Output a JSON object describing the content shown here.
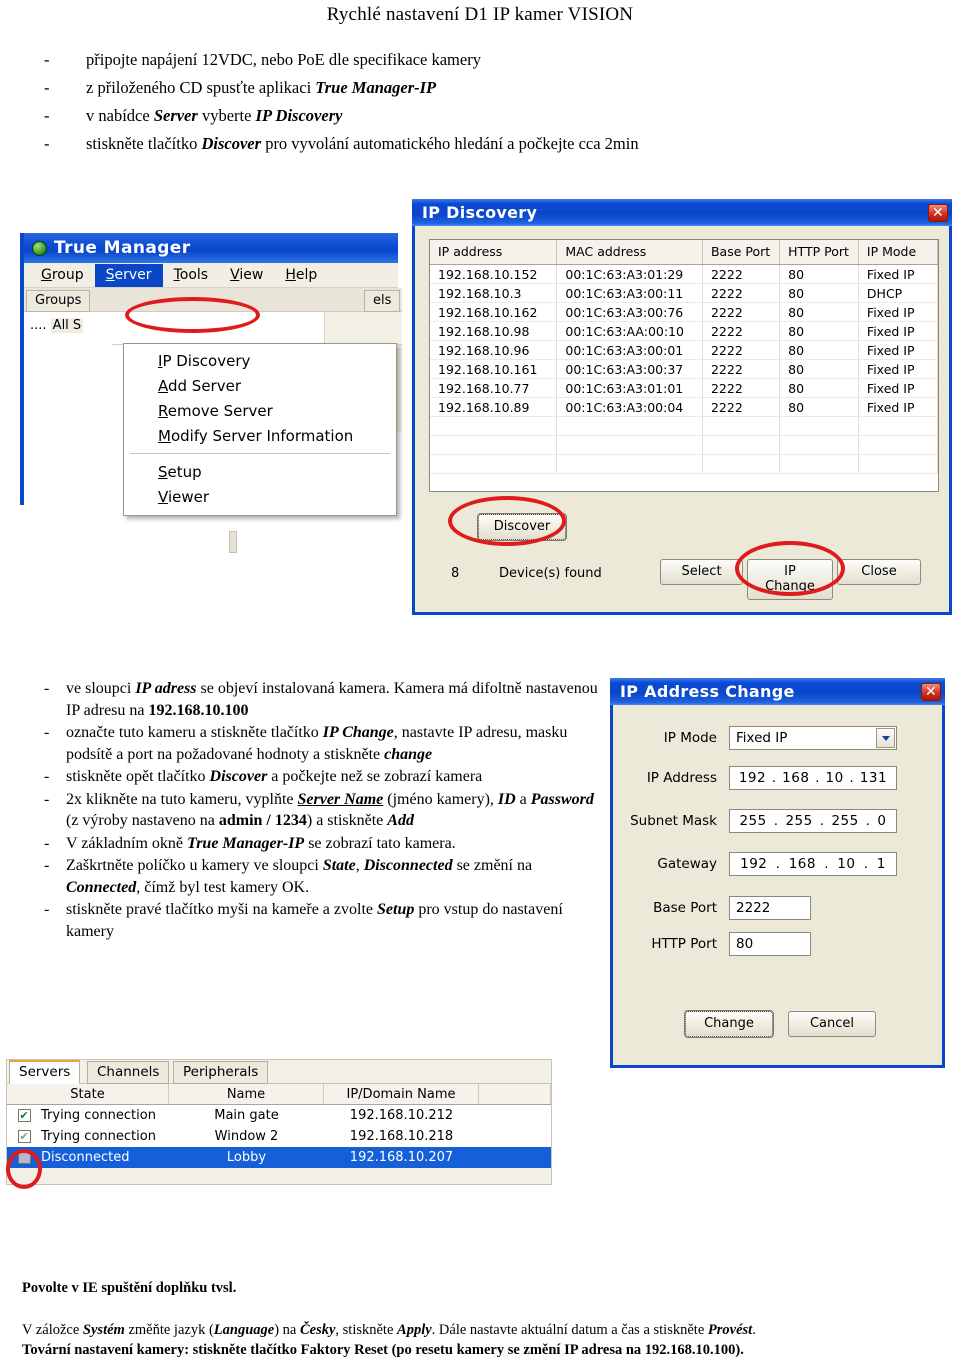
{
  "document": {
    "title": "Rychlé nastavení D1 IP kamer VISION",
    "intro_bullets": [
      {
        "dash": "-",
        "parts": [
          {
            "t": "připojte napájení 12VDC, nebo PoE dle specifikace kamery",
            "s": "n"
          }
        ]
      },
      {
        "dash": "-",
        "parts": [
          {
            "t": "z přiloženého CD spusťte aplikaci ",
            "s": "n"
          },
          {
            "t": "True Manager-IP",
            "s": "bi"
          }
        ]
      },
      {
        "dash": "-",
        "parts": [
          {
            "t": "v nabídce ",
            "s": "n"
          },
          {
            "t": "Server",
            "s": "bi"
          },
          {
            "t": "  vyberte ",
            "s": "n"
          },
          {
            "t": "IP Discovery",
            "s": "bi"
          }
        ]
      },
      {
        "dash": "-",
        "parts": [
          {
            "t": "stiskněte tlačítko ",
            "s": "n"
          },
          {
            "t": "Discover",
            "s": "bi"
          },
          {
            "t": "  pro vyvolání automatického hledání a počkejte cca 2min",
            "s": "n"
          }
        ]
      }
    ]
  },
  "true_manager": {
    "title": "True Manager",
    "app_icon": "true-manager-app-icon",
    "menu": [
      {
        "label": "Group",
        "mnemonic": "G",
        "active": false
      },
      {
        "label": "Server",
        "mnemonic": "S",
        "active": true
      },
      {
        "label": "Tools",
        "mnemonic": "T",
        "active": false
      },
      {
        "label": "View",
        "mnemonic": "V",
        "active": false
      },
      {
        "label": "Help",
        "mnemonic": "H",
        "active": false
      }
    ],
    "tabs": [
      "Groups",
      "els"
    ],
    "tree_node": "All S",
    "dropdown": {
      "items": [
        {
          "label": "IP Discovery",
          "mnemonic": "I",
          "sep_after": false
        },
        {
          "label": "Add Server",
          "mnemonic": "A",
          "sep_after": false
        },
        {
          "label": "Remove Server",
          "mnemonic": "R",
          "sep_after": false
        },
        {
          "label": "Modify Server Information",
          "mnemonic": "M",
          "sep_after": true
        },
        {
          "label": "Setup",
          "mnemonic": "S",
          "sep_after": false
        },
        {
          "label": "Viewer",
          "mnemonic": "V",
          "sep_after": false
        }
      ]
    }
  },
  "ip_discovery": {
    "title": "IP Discovery",
    "close_glyph": "✕",
    "columns": [
      "IP address",
      "MAC address",
      "Base Port",
      "HTTP Port",
      "IP Mode"
    ],
    "rows": [
      [
        "192.168.10.152",
        "00:1C:63:A3:01:29",
        "2222",
        "80",
        "Fixed IP"
      ],
      [
        "192.168.10.3",
        "00:1C:63:A3:00:11",
        "2222",
        "80",
        "DHCP"
      ],
      [
        "192.168.10.162",
        "00:1C:63:A3:00:76",
        "2222",
        "80",
        "Fixed IP"
      ],
      [
        "192.168.10.98",
        "00:1C:63:AA:00:10",
        "2222",
        "80",
        "Fixed IP"
      ],
      [
        "192.168.10.96",
        "00:1C:63:A3:00:01",
        "2222",
        "80",
        "Fixed IP"
      ],
      [
        "192.168.10.161",
        "00:1C:63:A3:00:37",
        "2222",
        "80",
        "Fixed IP"
      ],
      [
        "192.168.10.77",
        "00:1C:63:A3:01:01",
        "2222",
        "80",
        "Fixed IP"
      ],
      [
        "192.168.10.89",
        "00:1C:63:A3:00:04",
        "2222",
        "80",
        "Fixed IP"
      ]
    ],
    "discover_button": "Discover",
    "device_count": "8",
    "device_found_label": "Device(s) found",
    "select_button": "Select",
    "ip_change_button": "IP Change",
    "close_button": "Close"
  },
  "ip_address_change": {
    "title": "IP Address Change",
    "close_glyph": "✕",
    "fields": {
      "ip_mode_label": "IP Mode",
      "ip_mode_value": "Fixed IP",
      "ip_address_label": "IP Address",
      "ip_address_octets": [
        "192",
        "168",
        "10",
        "131"
      ],
      "subnet_mask_label": "Subnet Mask",
      "subnet_mask_octets": [
        "255",
        "255",
        "255",
        "0"
      ],
      "gateway_label": "Gateway",
      "gateway_octets": [
        "192",
        "168",
        "10",
        "1"
      ],
      "base_port_label": "Base Port",
      "base_port_value": "2222",
      "http_port_label": "HTTP Port",
      "http_port_value": "80"
    },
    "change_button": "Change",
    "cancel_button": "Cancel"
  },
  "mid_instructions": [
    {
      "dash": "-",
      "parts": [
        {
          "t": "ve sloupci ",
          "s": "n"
        },
        {
          "t": "IP adress",
          "s": "bi"
        },
        {
          "t": " se objeví instalovaná kamera. Kamera má difoltně nastavenou IP adresu na ",
          "s": "n"
        },
        {
          "t": "192.168.10.100",
          "s": "b"
        }
      ]
    },
    {
      "dash": "-",
      "parts": [
        {
          "t": "označte tuto kameru a stiskněte tlačítko ",
          "s": "n"
        },
        {
          "t": "IP Change",
          "s": "bi"
        },
        {
          "t": ", nastavte IP adresu, masku podsítě a port na požadované hodnoty a stiskněte ",
          "s": "n"
        },
        {
          "t": "change",
          "s": "bi"
        }
      ]
    },
    {
      "dash": "-",
      "parts": [
        {
          "t": "stiskněte opět tlačítko ",
          "s": "n"
        },
        {
          "t": "Discover",
          "s": "bi"
        },
        {
          "t": " a počkejte než se zobrazí kamera",
          "s": "n"
        }
      ]
    },
    {
      "dash": "-",
      "parts": [
        {
          "t": "2x klikněte na tuto kameru, vyplňte ",
          "s": "n"
        },
        {
          "t": "Server Name",
          "s": "u"
        },
        {
          "t": " (jméno kamery), ",
          "s": "n"
        },
        {
          "t": "ID",
          "s": "bi"
        },
        {
          "t": " a ",
          "s": "n"
        },
        {
          "t": "Password",
          "s": "bi"
        },
        {
          "t": " (z výroby nastaveno na ",
          "s": "n"
        },
        {
          "t": "admin / 1234",
          "s": "b"
        },
        {
          "t": ") a stiskněte ",
          "s": "n"
        },
        {
          "t": "Add",
          "s": "bi"
        }
      ]
    },
    {
      "dash": "-",
      "parts": [
        {
          "t": "V základním okně ",
          "s": "n"
        },
        {
          "t": "True Manager-IP",
          "s": "bi"
        },
        {
          "t": " se zobrazí tato kamera.",
          "s": "n"
        }
      ]
    },
    {
      "dash": "-",
      "parts": [
        {
          "t": "Zaškrtněte políčko u kamery ve sloupci ",
          "s": "n"
        },
        {
          "t": "State",
          "s": "bi"
        },
        {
          "t": ",  ",
          "s": "n"
        },
        {
          "t": "Disconnected",
          "s": "bi"
        },
        {
          "t": " se změní na ",
          "s": "n"
        },
        {
          "t": "Connected",
          "s": "bi"
        },
        {
          "t": ", čímž byl test kamery OK.",
          "s": "n"
        }
      ]
    },
    {
      "dash": "-",
      "parts": [
        {
          "t": "stiskněte pravé tlačítko myši na kameře a zvolte ",
          "s": "n"
        },
        {
          "t": "Setup",
          "s": "bi"
        },
        {
          "t": " pro vstup do nastavení kamery",
          "s": "n"
        }
      ]
    }
  ],
  "servers_panel": {
    "tabs": [
      {
        "label": "Servers",
        "selected": true
      },
      {
        "label": "Channels",
        "selected": false
      },
      {
        "label": "Peripherals",
        "selected": false
      }
    ],
    "columns": [
      "State",
      "Name",
      "IP/Domain Name"
    ],
    "rows": [
      {
        "checked": "checked",
        "state": "Trying connection",
        "name": "Main gate",
        "ip": "192.168.10.212",
        "selected": false
      },
      {
        "checked": "checked-faded",
        "state": "Trying connection",
        "name": "Window 2",
        "ip": "192.168.10.218",
        "selected": false
      },
      {
        "checked": "grey",
        "state": "Disconnected",
        "name": "Lobby",
        "ip": "192.168.10.207",
        "selected": true
      }
    ],
    "check_glyph": "✔"
  },
  "footer": {
    "line1": "Povolte v IE spuštění doplňku tvsl.",
    "line2_parts": [
      {
        "t": "V záložce ",
        "s": "n"
      },
      {
        "t": "Systém",
        "s": "bi"
      },
      {
        "t": " změňte jazyk (",
        "s": "n"
      },
      {
        "t": "Language",
        "s": "bi"
      },
      {
        "t": ") na ",
        "s": "n"
      },
      {
        "t": "Česky",
        "s": "bi"
      },
      {
        "t": ", stiskněte ",
        "s": "n"
      },
      {
        "t": "Apply",
        "s": "bi"
      },
      {
        "t": ". Dále nastavte aktuální datum a čas a stiskněte ",
        "s": "n"
      },
      {
        "t": "Provést",
        "s": "bi"
      },
      {
        "t": ".",
        "s": "n"
      }
    ],
    "line3_parts": [
      {
        "t": "Tovární nastavení kamery",
        "s": "b"
      },
      {
        "t": ": stiskněte tlačítko Faktory Reset (po resetu kamery se změní IP adresa na 192.168.10.100).",
        "s": "n"
      }
    ]
  },
  "annotations": {
    "colors": {
      "highlight": "#e01b1b",
      "title_bar": "#0a46c8",
      "selection": "#1560d8"
    },
    "ellipses": [
      "ip-discovery-menu-item",
      "discover-button",
      "ip-change-button",
      "servers-checkbox"
    ]
  }
}
